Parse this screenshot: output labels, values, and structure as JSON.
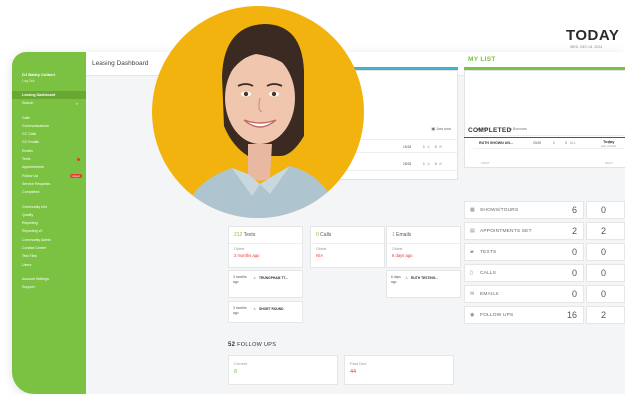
{
  "sidebar": {
    "user": "DJ Bailey Colbert",
    "logout": "Log Out",
    "items": [
      {
        "label": "Leasing Dashboard",
        "active": true
      },
      {
        "label": "Search"
      },
      {
        "gap": true
      },
      {
        "label": "Calls"
      },
      {
        "label": "Communications"
      },
      {
        "label": "CC Calls"
      },
      {
        "label": "CC Emails"
      },
      {
        "label": "Emails"
      },
      {
        "label": "Texts",
        "dot": true
      },
      {
        "label": "Appointments"
      },
      {
        "label": "Follow Up",
        "tag": "Urgent"
      },
      {
        "label": "Service Requests"
      },
      {
        "label": "Completed"
      },
      {
        "gap": true
      },
      {
        "label": "Community Info"
      },
      {
        "label": "Quality"
      },
      {
        "label": "Reporting"
      },
      {
        "label": "Reporting v2"
      },
      {
        "label": "Community Admin"
      },
      {
        "label": "Contact Center"
      },
      {
        "label": "Test Tiles"
      },
      {
        "label": "Users"
      },
      {
        "gap": true
      },
      {
        "label": "Account Settings"
      },
      {
        "label": "Support"
      }
    ]
  },
  "header": {
    "title": "Leasing Dashboard"
  },
  "today": {
    "label": "TODAY",
    "date": "WED, DEC 04, 2024"
  },
  "left_panel": {
    "action": "Just now",
    "rows": [
      {
        "date": "18/18",
        "a": "1",
        "b": "0"
      },
      {
        "date": "28/28",
        "a": "1",
        "b": "0"
      }
    ]
  },
  "my_list": {
    "title": "MY LIST",
    "filters": [
      "Lists",
      "Bonuses"
    ],
    "item_name": "RUTH SHOWN UN...",
    "item_date": "20/20",
    "item_a": "1",
    "item_b": "0",
    "item_badge": "Today",
    "item_sub": "past contact",
    "col_left": "FIRST",
    "col_right": "NEXT"
  },
  "completed": {
    "title": "COMPLETED",
    "col_all": "ALL",
    "col_me": "M",
    "rows": [
      {
        "label": "SHOWS/TOURS",
        "icon": "building-icon",
        "all": "6",
        "me": "0"
      },
      {
        "label": "APPOINTMENTS SET",
        "icon": "calendar-icon",
        "all": "2",
        "me": "2"
      },
      {
        "label": "TEXTS",
        "icon": "chat-icon",
        "all": "0",
        "me": "0"
      },
      {
        "label": "CALLS",
        "icon": "phone-icon",
        "all": "0",
        "me": "0"
      },
      {
        "label": "EMAILS",
        "icon": "mail-icon",
        "all": "0",
        "me": "0"
      },
      {
        "label": "FOLLOW UPS",
        "icon": "target-icon",
        "all": "16",
        "me": "2"
      }
    ]
  },
  "stats": [
    {
      "count": "212",
      "label": "Texts",
      "sub_label": "Oldest",
      "sub_value": "3 months ago"
    },
    {
      "count": "0",
      "label": "Calls",
      "sub_label": "Oldest",
      "sub_value": "N/A"
    },
    {
      "count": "1",
      "label": "Emails",
      "sub_label": "Oldest",
      "sub_value": "6 days ago"
    }
  ],
  "mini_texts": [
    {
      "age": "3 months ago",
      "name": "TRUNGPHAM TT..."
    },
    {
      "age": "3 months ago",
      "name": "SHORT ROUND"
    }
  ],
  "mini_emails": [
    {
      "age": "6 days ago",
      "name": "RUTH TESTING..."
    }
  ],
  "followups": {
    "count": "52",
    "title": "FOLLOW UPS",
    "current_label": "Current",
    "current_value": "8",
    "past_label": "Past Due",
    "past_value": "44"
  },
  "colors": {
    "brand_green": "#7cc242",
    "accent_blue": "#3cb4d0",
    "photo_bg": "#f2b30e",
    "alert_red": "#e53935"
  }
}
